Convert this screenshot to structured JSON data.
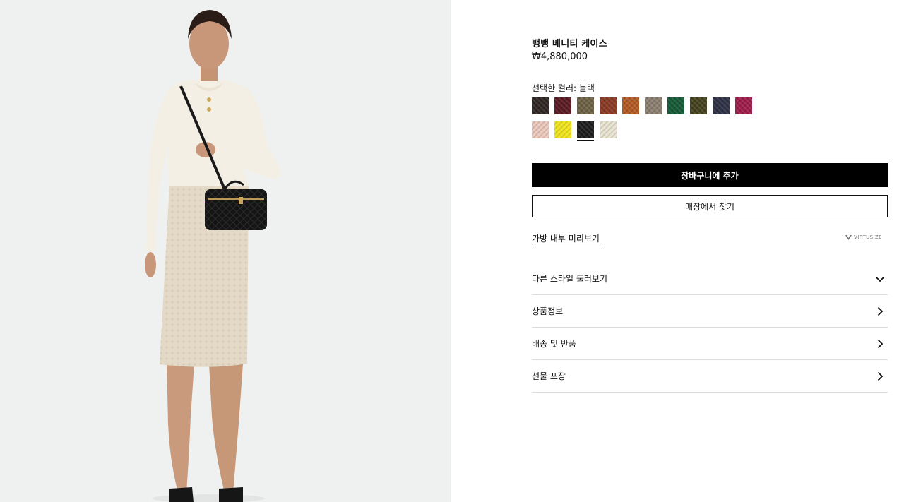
{
  "product": {
    "title": "뱅뱅 베니티 케이스",
    "price": "₩4,880,000"
  },
  "color": {
    "label": "선택한 컬러: 블랙",
    "swatches_row1": [
      {
        "name": "dark-brown",
        "hex": "#2e2622"
      },
      {
        "name": "burgundy",
        "hex": "#5b1a22"
      },
      {
        "name": "olive-taupe",
        "hex": "#6e6246"
      },
      {
        "name": "rust",
        "hex": "#8a3a24"
      },
      {
        "name": "copper",
        "hex": "#b35a24"
      },
      {
        "name": "taupe",
        "hex": "#8c7e70"
      },
      {
        "name": "green",
        "hex": "#145a36"
      },
      {
        "name": "moss",
        "hex": "#45421e"
      },
      {
        "name": "navy",
        "hex": "#2e3146"
      },
      {
        "name": "raspberry",
        "hex": "#9e1c4a"
      }
    ],
    "swatches_row2": [
      {
        "name": "pink",
        "hex": "#ecc9bd"
      },
      {
        "name": "yellow",
        "hex": "#f1e51c"
      },
      {
        "name": "black",
        "hex": "#1d1d1d",
        "selected": true
      },
      {
        "name": "cream",
        "hex": "#e9e4d2"
      }
    ]
  },
  "actions": {
    "add_to_cart": "장바구니에 추가",
    "find_in_store": "매장에서 찾기",
    "preview_inside": "가방 내부 미리보기",
    "virtusize_logo": "VIRTUSIZE"
  },
  "accordion": [
    {
      "label": "다른 스타일 둘러보기",
      "icon": "chevron-down-icon"
    },
    {
      "label": "상품정보",
      "icon": "chevron-right-icon"
    },
    {
      "label": "배송 및 반품",
      "icon": "chevron-right-icon"
    },
    {
      "label": "선물 포장",
      "icon": "chevron-right-icon"
    }
  ],
  "colors": {
    "photo_background": "#eff1f1",
    "primary": "#000000"
  }
}
